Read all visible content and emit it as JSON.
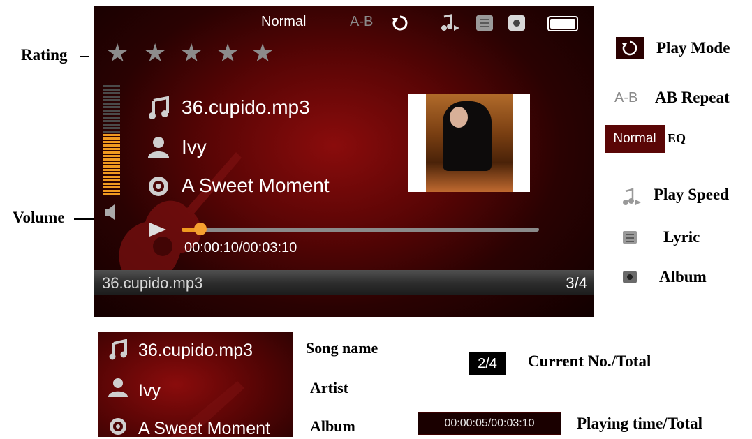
{
  "screen": {
    "status": {
      "eq": "Normal",
      "ab": "A-B"
    },
    "rating": {
      "stars": 5
    },
    "song": {
      "title": "36.cupido.mp3",
      "artist": "Ivy",
      "album": "A Sweet Moment"
    },
    "playback": {
      "time": "00:00:10/00:03:10",
      "progress": 0.0526
    },
    "bottom": {
      "filename": "36.cupido.mp3",
      "count": "3/4"
    },
    "volume": {
      "level": 0.55
    }
  },
  "annotations": {
    "rating": "Rating",
    "volume": "Volume",
    "play_mode": "Play Mode",
    "ab_icon": "A-B",
    "ab_repeat": "AB Repeat",
    "eq_badge": "Normal",
    "eq": "EQ",
    "play_speed": "Play Speed",
    "lyric": "Lyric",
    "album": "Album",
    "song_name": "Song name",
    "artist": "Artist",
    "album_bottom": "Album",
    "count_badge": "2/4",
    "current_total": "Current No./Total",
    "time_badge": "00:00:05/00:03:10",
    "playing_time": "Playing time/Total"
  },
  "zoom": {
    "title": "36.cupido.mp3",
    "artist": "Ivy",
    "album": "A Sweet Moment"
  },
  "colors": {
    "accent": "#f09a20",
    "background": "#5a0505"
  },
  "icons": [
    "music-note-icon",
    "person-icon",
    "disc-icon",
    "play-icon",
    "speaker-icon",
    "repeat-icon",
    "play-speed-icon",
    "lyric-icon",
    "album-icon",
    "battery-icon"
  ]
}
